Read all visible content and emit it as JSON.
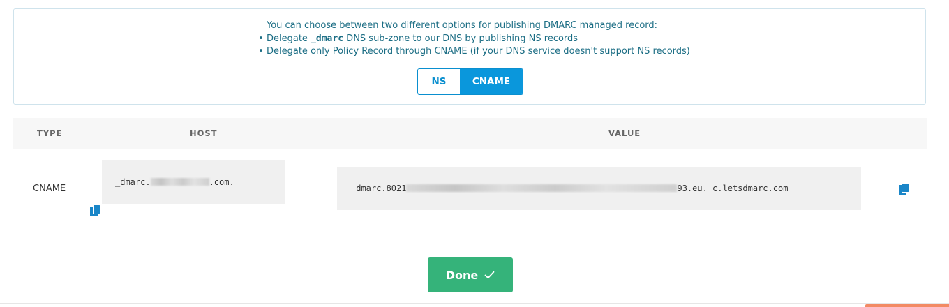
{
  "info": {
    "title": "You can choose between two different options for publishing DMARC managed record:",
    "bullets": [
      {
        "prefix": "Delegate ",
        "code": "_dmarc",
        "suffix": " DNS sub-zone to our DNS by publishing NS records"
      },
      {
        "prefix": "Delegate only Policy Record through CNAME (if your DNS service doesn't support NS records)",
        "code": "",
        "suffix": ""
      }
    ],
    "bullet_char": "•"
  },
  "toggle": {
    "options": [
      "NS",
      "CNAME"
    ],
    "selected": "CNAME"
  },
  "table": {
    "headers": {
      "type": "TYPE",
      "host": "HOST",
      "value": "VALUE"
    },
    "row": {
      "type": "CNAME",
      "host_prefix": "_dmarc.",
      "host_suffix": ".com.",
      "value_prefix": "_dmarc.8021",
      "value_suffix": "93.eu._c.letsdmarc.com"
    }
  },
  "icons": {
    "copy": "copy-icon",
    "done": "checkmark-icon"
  },
  "done_button": {
    "label": "Done"
  },
  "colors": {
    "info_text": "#1b6d84",
    "toggle_accent": "#0a97dc",
    "done_green": "#35b37a",
    "copy_icon": "#1a86c8"
  }
}
